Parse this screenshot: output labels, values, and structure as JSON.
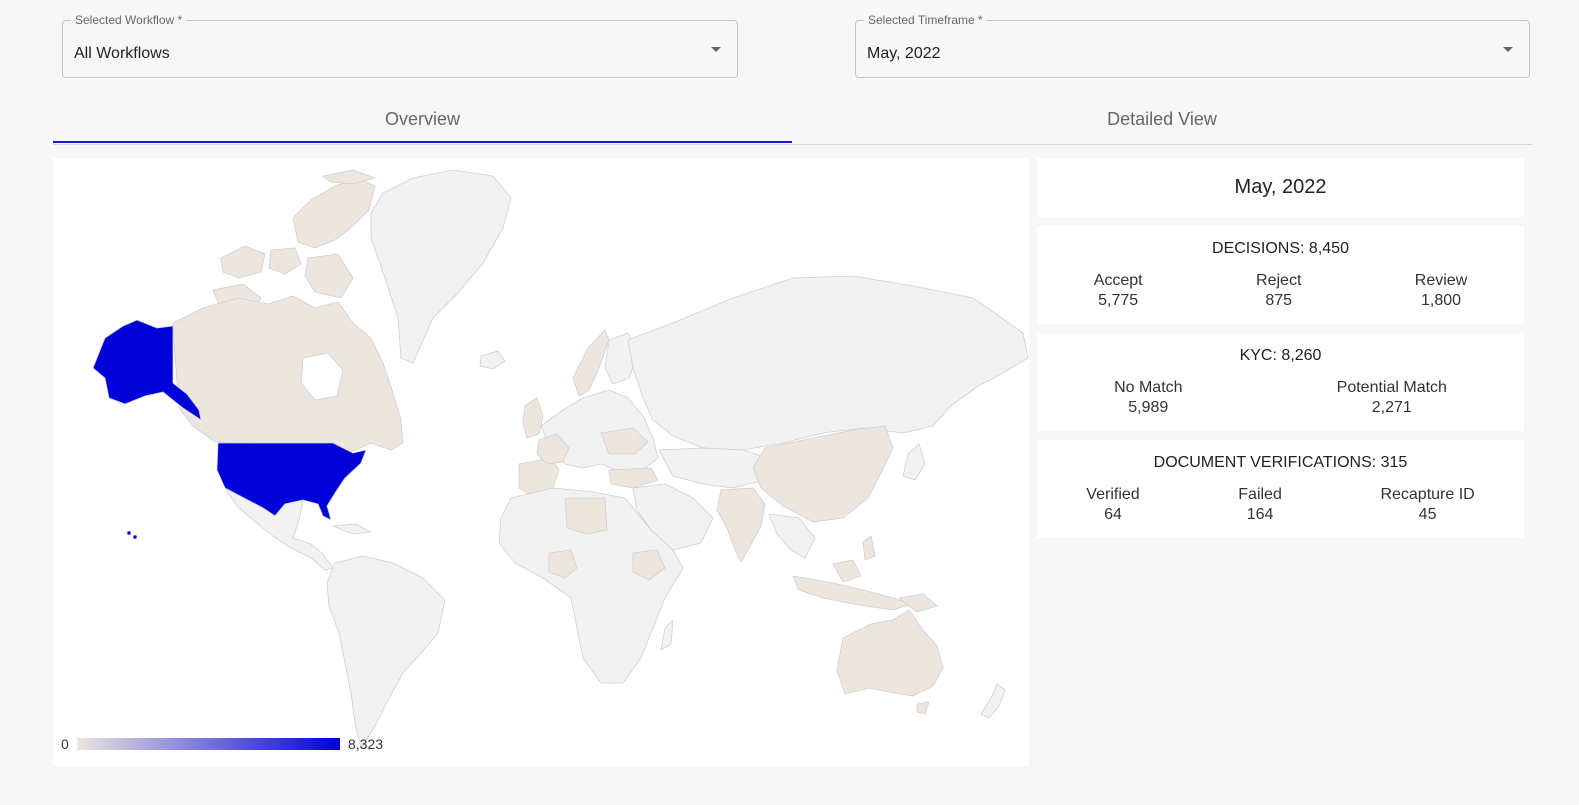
{
  "filters": {
    "workflow": {
      "label": "Selected Workflow *",
      "value": "All Workflows"
    },
    "timeframe": {
      "label": "Selected Timeframe *",
      "value": "May, 2022"
    }
  },
  "tabs": [
    {
      "label": "Overview",
      "active": true
    },
    {
      "label": "Detailed View",
      "active": false
    }
  ],
  "map": {
    "legend_min": "0",
    "legend_max": "8,323",
    "scale_colors": {
      "low": "#ece6df",
      "high": "#0000d9",
      "empty": "#f2f2f2"
    },
    "highlighted": [
      {
        "country": "United States",
        "color": "#0000d9"
      },
      {
        "country": "Alaska (US)",
        "color": "#0000d9"
      },
      {
        "country": "Canada",
        "color": "#ece6df"
      },
      {
        "country": "Australia",
        "color": "#ece6df"
      },
      {
        "country": "China",
        "color": "#ece6df"
      },
      {
        "country": "India",
        "color": "#ece6df"
      }
    ]
  },
  "summary": {
    "period": "May, 2022",
    "decisions": {
      "title": "DECISIONS: 8,450",
      "stats": [
        {
          "label": "Accept",
          "value": "5,775"
        },
        {
          "label": "Reject",
          "value": "875"
        },
        {
          "label": "Review",
          "value": "1,800"
        }
      ]
    },
    "kyc": {
      "title": "KYC: 8,260",
      "stats": [
        {
          "label": "No Match",
          "value": "5,989"
        },
        {
          "label": "Potential Match",
          "value": "2,271"
        }
      ]
    },
    "documents": {
      "title": "DOCUMENT VERIFICATIONS: 315",
      "stats": [
        {
          "label": "Verified",
          "value": "64"
        },
        {
          "label": "Failed",
          "value": "164"
        },
        {
          "label": "Recapture ID",
          "value": "45"
        }
      ]
    }
  }
}
